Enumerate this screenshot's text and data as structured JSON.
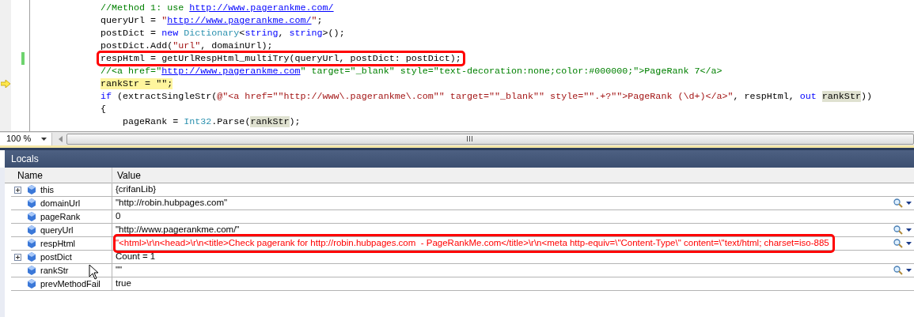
{
  "editor": {
    "lines": [
      {
        "current": false,
        "changed": false,
        "annotated": false,
        "tokens": [
          {
            "kind": "comment",
            "text": "//Method 1: use "
          },
          {
            "kind": "comment-link",
            "text": "http://www.pagerankme.com/"
          }
        ]
      },
      {
        "current": false,
        "changed": false,
        "annotated": false,
        "tokens": [
          {
            "kind": "plain",
            "text": "queryUrl = "
          },
          {
            "kind": "string",
            "text": "\""
          },
          {
            "kind": "string-link",
            "text": "http://www.pagerankme.com/"
          },
          {
            "kind": "string",
            "text": "\""
          },
          {
            "kind": "plain",
            "text": ";"
          }
        ]
      },
      {
        "current": false,
        "changed": false,
        "annotated": false,
        "tokens": [
          {
            "kind": "plain",
            "text": "postDict = "
          },
          {
            "kind": "keyword",
            "text": "new "
          },
          {
            "kind": "type",
            "text": "Dictionary"
          },
          {
            "kind": "plain",
            "text": "<"
          },
          {
            "kind": "keyword",
            "text": "string"
          },
          {
            "kind": "plain",
            "text": ", "
          },
          {
            "kind": "keyword",
            "text": "string"
          },
          {
            "kind": "plain",
            "text": ">();"
          }
        ]
      },
      {
        "current": false,
        "changed": false,
        "annotated": false,
        "tokens": [
          {
            "kind": "plain",
            "text": "postDict.Add("
          },
          {
            "kind": "string",
            "text": "\"url\""
          },
          {
            "kind": "plain",
            "text": ", domainUrl);"
          }
        ]
      },
      {
        "current": false,
        "changed": true,
        "annotated": true,
        "tokens": [
          {
            "kind": "plain",
            "text": "respHtml = getUrlRespHtml_multiTry(queryUrl, postDict: postDict);"
          }
        ]
      },
      {
        "current": false,
        "changed": false,
        "annotated": false,
        "tokens": [
          {
            "kind": "comment",
            "text": "//<a href=\""
          },
          {
            "kind": "comment-link",
            "text": "http://www.pagerankme.com"
          },
          {
            "kind": "comment",
            "text": "\" target=\"_blank\" style=\"text-decoration:none;color:#000000;\">PageRank 7</a>"
          }
        ]
      },
      {
        "current": true,
        "changed": false,
        "annotated": false,
        "tokens": [
          {
            "kind": "current",
            "text": "rankStr = \"\";"
          }
        ]
      },
      {
        "current": false,
        "changed": false,
        "annotated": false,
        "tokens": [
          {
            "kind": "keyword",
            "text": "if"
          },
          {
            "kind": "plain",
            "text": " (extractSingleStr("
          },
          {
            "kind": "string",
            "text": "@\"<a href=\"\"http://www\\.pagerankme\\.com\"\" target=\"\"_blank\"\" style=\"\".+?\"\">PageRank (\\d+)</a>\""
          },
          {
            "kind": "plain",
            "text": ", respHtml, "
          },
          {
            "kind": "keyword",
            "text": "out "
          },
          {
            "kind": "reference",
            "text": "rankStr"
          },
          {
            "kind": "plain",
            "text": "))"
          }
        ]
      },
      {
        "current": false,
        "changed": false,
        "annotated": false,
        "tokens": [
          {
            "kind": "plain",
            "text": "{"
          }
        ]
      },
      {
        "current": false,
        "changed": false,
        "annotated": false,
        "tokens": [
          {
            "kind": "plain",
            "text": "    pageRank = "
          },
          {
            "kind": "type",
            "text": "Int32"
          },
          {
            "kind": "plain",
            "text": ".Parse("
          },
          {
            "kind": "reference",
            "text": "rankStr"
          },
          {
            "kind": "plain",
            "text": ");"
          }
        ]
      }
    ],
    "zoom": "100 %"
  },
  "locals": {
    "title": "Locals",
    "columns": [
      "Name",
      "Value"
    ],
    "rows": [
      {
        "name": "this",
        "value": "{crifanLib}",
        "expandable": true,
        "visualizer": false,
        "changed": false,
        "annotated": false
      },
      {
        "name": "domainUrl",
        "value": "\"http://robin.hubpages.com\"",
        "expandable": false,
        "visualizer": true,
        "changed": false,
        "annotated": false
      },
      {
        "name": "pageRank",
        "value": "0",
        "expandable": false,
        "visualizer": false,
        "changed": false,
        "annotated": false
      },
      {
        "name": "queryUrl",
        "value": "\"http://www.pagerankme.com/\"",
        "expandable": false,
        "visualizer": true,
        "changed": false,
        "annotated": false
      },
      {
        "name": "respHtml",
        "value": "\"<html>\\r\\n<head>\\r\\n<title>Check pagerank for http://robin.hubpages.com  - PageRankMe.com</title>\\r\\n<meta http-equiv=\\\"Content-Type\\\" content=\\\"text/html; charset=iso-885",
        "expandable": false,
        "visualizer": true,
        "changed": true,
        "annotated": true
      },
      {
        "name": "postDict",
        "value": "Count = 1",
        "expandable": true,
        "visualizer": false,
        "changed": false,
        "annotated": false
      },
      {
        "name": "rankStr",
        "value": "\"\"",
        "expandable": false,
        "visualizer": true,
        "changed": false,
        "annotated": false
      },
      {
        "name": "prevMethodFail",
        "value": "true",
        "expandable": false,
        "visualizer": false,
        "changed": false,
        "annotated": false
      }
    ]
  }
}
